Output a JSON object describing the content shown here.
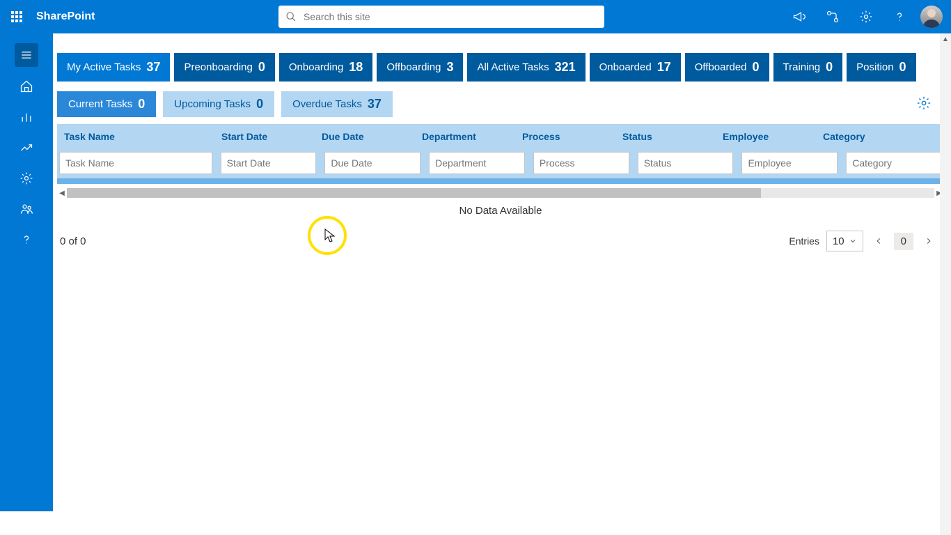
{
  "header": {
    "brand": "SharePoint",
    "search_placeholder": "Search this site"
  },
  "top_tabs": [
    {
      "label": "My Active Tasks",
      "count": "37"
    },
    {
      "label": "Preonboarding",
      "count": "0"
    },
    {
      "label": "Onboarding",
      "count": "18"
    },
    {
      "label": "Offboarding",
      "count": "3"
    },
    {
      "label": "All Active Tasks",
      "count": "321"
    },
    {
      "label": "Onboarded",
      "count": "17"
    },
    {
      "label": "Offboarded",
      "count": "0"
    },
    {
      "label": "Training",
      "count": "0"
    },
    {
      "label": "Position",
      "count": "0"
    }
  ],
  "sub_tabs": [
    {
      "label": "Current Tasks",
      "count": "0"
    },
    {
      "label": "Upcoming Tasks",
      "count": "0"
    },
    {
      "label": "Overdue Tasks",
      "count": "37"
    }
  ],
  "columns": {
    "task": "Task Name",
    "start": "Start Date",
    "due": "Due Date",
    "dept": "Department",
    "proc": "Process",
    "status": "Status",
    "emp": "Employee",
    "cat": "Category"
  },
  "filters": {
    "task": "Task Name",
    "start": "Start Date",
    "due": "Due Date",
    "dept": "Department",
    "proc": "Process",
    "status": "Status",
    "emp": "Employee",
    "cat": "Category"
  },
  "table": {
    "no_data": "No Data Available"
  },
  "footer": {
    "range": "0 of 0",
    "entries_label": "Entries",
    "entries_value": "10",
    "page": "0"
  }
}
